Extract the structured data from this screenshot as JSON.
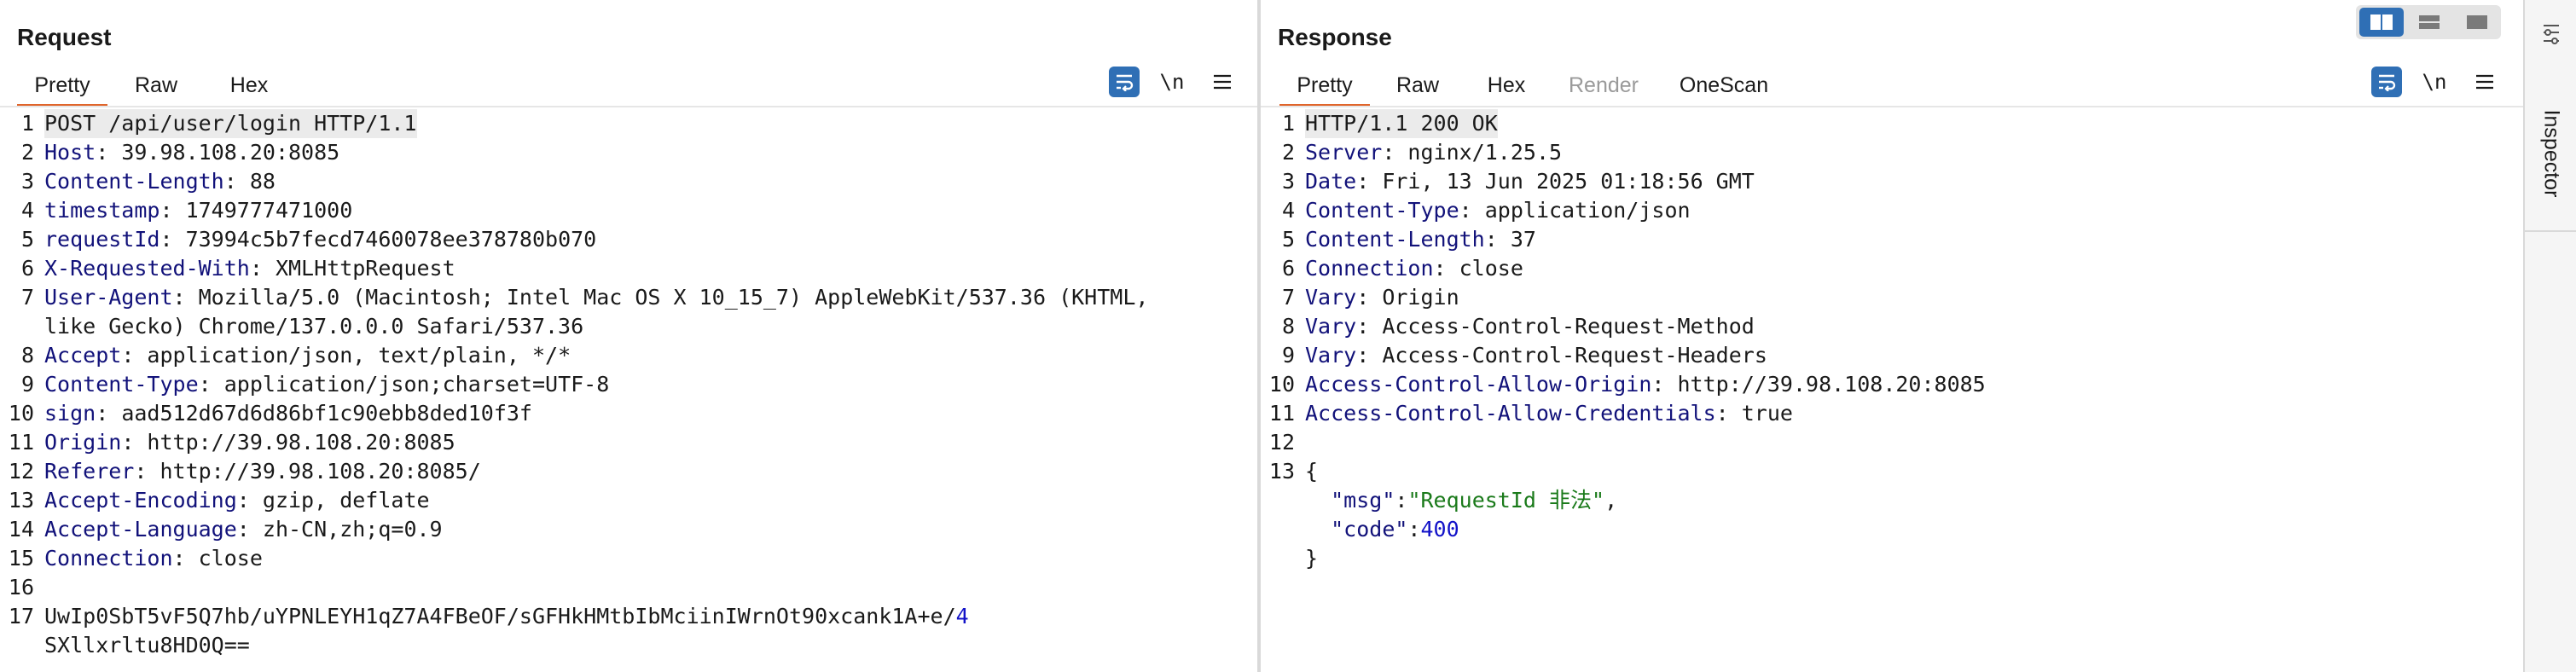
{
  "request": {
    "title": "Request",
    "tabs": [
      {
        "label": "Pretty",
        "active": true
      },
      {
        "label": "Raw",
        "active": false
      },
      {
        "label": "Hex",
        "active": false
      }
    ],
    "newline_label": "\\n",
    "lines": [
      {
        "num": "1",
        "text": "POST /api/user/login HTTP/1.1"
      },
      {
        "num": "2",
        "key": "Host",
        "value": " 39.98.108.20:8085"
      },
      {
        "num": "3",
        "key": "Content-Length",
        "value": " 88"
      },
      {
        "num": "4",
        "key": "timestamp",
        "value": " 1749777471000"
      },
      {
        "num": "5",
        "key": "requestId",
        "value": " 73994c5b7fecd7460078ee378780b070"
      },
      {
        "num": "6",
        "key": "X-Requested-With",
        "value": " XMLHttpRequest"
      },
      {
        "num": "7",
        "key": "User-Agent",
        "value": " Mozilla/5.0 (Macintosh; Intel Mac OS X 10_15_7) AppleWebKit/537.36 (KHTML,"
      },
      {
        "num": "",
        "text": "like Gecko) Chrome/137.0.0.0 Safari/537.36"
      },
      {
        "num": "8",
        "key": "Accept",
        "value": " application/json, text/plain, */*"
      },
      {
        "num": "9",
        "key": "Content-Type",
        "value": " application/json;charset=UTF-8"
      },
      {
        "num": "10",
        "key": "sign",
        "value": " aad512d67d6d86bf1c90ebb8ded10f3f"
      },
      {
        "num": "11",
        "key": "Origin",
        "value": " http://39.98.108.20:8085"
      },
      {
        "num": "12",
        "key": "Referer",
        "value": " http://39.98.108.20:8085/"
      },
      {
        "num": "13",
        "key": "Accept-Encoding",
        "value": " gzip, deflate"
      },
      {
        "num": "14",
        "key": "Accept-Language",
        "value": " zh-CN,zh;q=0.9"
      },
      {
        "num": "15",
        "key": "Connection",
        "value": " close"
      },
      {
        "num": "16",
        "text": ""
      },
      {
        "num": "17",
        "text": "UwIp0SbT5vF5Q7hb/uYPNLEYH1qZ7A4FBeOF/sGFHkHMtbIbMciinIWrnOt90xcank1A+e/",
        "blue": "4"
      },
      {
        "num": "",
        "text": "SXllxrltu8HD0Q=="
      }
    ]
  },
  "response": {
    "title": "Response",
    "tabs": [
      {
        "label": "Pretty",
        "active": true,
        "disabled": false
      },
      {
        "label": "Raw",
        "active": false,
        "disabled": false
      },
      {
        "label": "Hex",
        "active": false,
        "disabled": false
      },
      {
        "label": "Render",
        "active": false,
        "disabled": true
      },
      {
        "label": "OneScan",
        "active": false,
        "disabled": false
      }
    ],
    "newline_label": "\\n",
    "lines": [
      {
        "num": "1",
        "text": "HTTP/1.1 200 OK"
      },
      {
        "num": "2",
        "key": "Server",
        "value": " nginx/1.25.5"
      },
      {
        "num": "3",
        "key": "Date",
        "value": " Fri, 13 Jun 2025 01:18:56 GMT"
      },
      {
        "num": "4",
        "key": "Content-Type",
        "value": " application/json"
      },
      {
        "num": "5",
        "key": "Content-Length",
        "value": " 37"
      },
      {
        "num": "6",
        "key": "Connection",
        "value": " close"
      },
      {
        "num": "7",
        "key": "Vary",
        "value": " Origin"
      },
      {
        "num": "8",
        "key": "Vary",
        "value": " Access-Control-Request-Method"
      },
      {
        "num": "9",
        "key": "Vary",
        "value": " Access-Control-Request-Headers"
      },
      {
        "num": "10",
        "key": "Access-Control-Allow-Origin",
        "value": " http://39.98.108.20:8085"
      },
      {
        "num": "11",
        "key": "Access-Control-Allow-Credentials",
        "value": " true"
      },
      {
        "num": "12",
        "text": ""
      },
      {
        "num": "13",
        "text": "{"
      },
      {
        "num": "",
        "indent": "  ",
        "jkey": "\"msg\"",
        "sep": ":",
        "jstr": "\"RequestId 非法\"",
        "tail": ","
      },
      {
        "num": "",
        "indent": "  ",
        "jkey": "\"code\"",
        "sep": ":",
        "jnum": "400"
      },
      {
        "num": "",
        "text": "}"
      }
    ]
  },
  "sidebar": {
    "inspector_label": "Inspector"
  },
  "colors": {
    "accent_tab": "#e0652b",
    "button_blue": "#2f6fb5",
    "header_key": "#12127a",
    "json_string": "#1a7a1a",
    "json_number": "#1212c8"
  },
  "icons": [
    "wrap-lines-icon",
    "hamburger-menu-icon",
    "layout-side-by-side-icon",
    "layout-stacked-icon",
    "layout-tabs-icon",
    "inspector-icon"
  ]
}
